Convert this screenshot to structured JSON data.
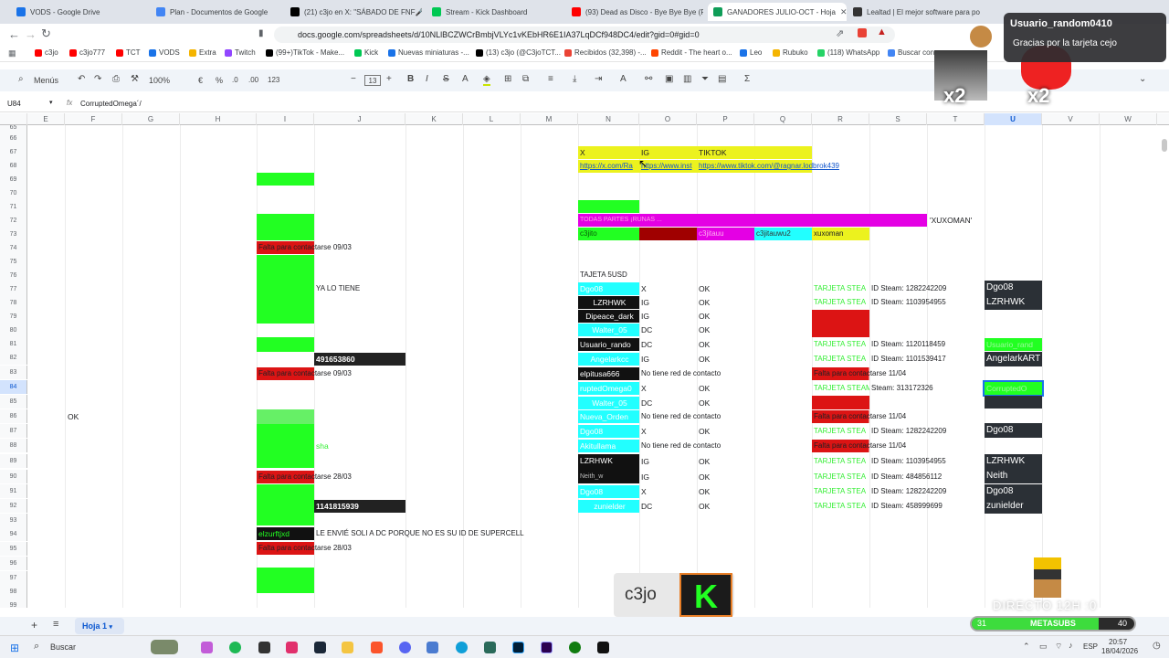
{
  "tabs": [
    {
      "label": "VODS - Google Drive",
      "color": "#1a73e8"
    },
    {
      "label": "Plan - Documentos de Google",
      "color": "#4285f4"
    },
    {
      "label": "(21) c3jo en X: \"SÁBADO DE FNF🎤",
      "color": "#000000"
    },
    {
      "label": "Stream - Kick Dashboard",
      "color": "#00c853"
    },
    {
      "label": "(93) Dead as Disco - Bye Bye Bye (Fr",
      "color": "#ff0000"
    },
    {
      "label": "GANADORES JULIO-OCT - Hoja",
      "color": "#0f9d58"
    },
    {
      "label": "Lealtad | El mejor software para pot",
      "color": "#333333"
    }
  ],
  "url": "docs.google.com/spreadsheets/d/10NLlBCZWCrBmbjVLYc1vKEbHR6E1IA37LqDCf948DC4/edit?gid=0#gid=0",
  "bookmarks": [
    {
      "label": "c3jo",
      "color": "#ff0000"
    },
    {
      "label": "c3jo777",
      "color": "#ff0000"
    },
    {
      "label": "TCT",
      "color": "#ff0000"
    },
    {
      "label": "VODS",
      "color": "#1a73e8"
    },
    {
      "label": "Extra",
      "color": "#f4b400"
    },
    {
      "label": "Twitch",
      "color": "#9146ff"
    },
    {
      "label": "(99+)TikTok - Make...",
      "color": "#000000"
    },
    {
      "label": "Kick",
      "color": "#00c853"
    },
    {
      "label": "Nuevas miniaturas -...",
      "color": "#1a73e8"
    },
    {
      "label": "(13) c3jo (@C3joTCT...",
      "color": "#000000"
    },
    {
      "label": "Recibidos (32,398) -...",
      "color": "#ea4335"
    },
    {
      "label": "Reddit - The heart o...",
      "color": "#ff4500"
    },
    {
      "label": "Leo",
      "color": "#1a73e8"
    },
    {
      "label": "Rubuko",
      "color": "#f4b400"
    },
    {
      "label": "(118) WhatsApp",
      "color": "#25d366"
    },
    {
      "label": "Buscar con",
      "color": "#4285f4"
    }
  ],
  "toolbar": {
    "menus": "Menús",
    "zoom": "100%",
    "currency": "€",
    "percent": "%",
    "dec_minus": ".0",
    "dec_plus": ".00",
    "format": "123",
    "font_size": "13",
    "sigma": "Σ"
  },
  "formula_bar": {
    "cell_ref": "U84",
    "content": "CorruptedOmega´/"
  },
  "columns": [
    "E",
    "F",
    "G",
    "H",
    "I",
    "J",
    "K",
    "L",
    "M",
    "N",
    "O",
    "P",
    "Q",
    "R",
    "S",
    "T",
    "U",
    "V",
    "W"
  ],
  "selected_column": "U",
  "rows": [
    "65",
    "66",
    "67",
    "68",
    "69",
    "70",
    "71",
    "72",
    "73",
    "74",
    "75",
    "76",
    "77",
    "78",
    "79",
    "80",
    "81",
    "82",
    "83",
    "84",
    "85",
    "86",
    "87",
    "88",
    "89",
    "90",
    "91",
    "92",
    "93",
    "94",
    "95",
    "96",
    "97",
    "98",
    "99"
  ],
  "selected_row": "84",
  "cells": {
    "f86": "OK",
    "n67": "X",
    "o67": "IG",
    "p67": "TIKTOK",
    "n68": "https://x.com/Ra",
    "o68": "https://www.inst",
    "p68": "https://www.tiktok.com/@ragnar.lodbrok439",
    "n72": "TODAS PARTES ¡RUNAS ...",
    "t72": "'XUXOMAN'",
    "n73": "c3jito",
    "o73": "",
    "p73": "c3jitauu",
    "q73": "c3jitauwu2",
    "r73": "xuxoman",
    "i74": "Falta para contactarse 09/03",
    "n76": "TAJETA 5USD",
    "j77": "YA LO TIENE",
    "n77": "Dgo08",
    "o77": "X",
    "p77": "OK",
    "r77": "TARJETA STEA",
    "s77": "ID Steam: 1282242209",
    "u77": "Dgo08",
    "n78": "LZRHWK",
    "o78": "IG",
    "p78": "OK",
    "r78": "TARJETA STEA",
    "s78": "ID Steam: 1103954955",
    "u78": "LZRHWK",
    "n79": "Dipeace_dark",
    "o79": "IG",
    "p79": "OK",
    "n80": "Walter_05",
    "o80": "DC",
    "p80": "OK",
    "n81": "Usuario_rando",
    "o81": "DC",
    "p81": "OK",
    "r81": "TARJETA STEA",
    "s81": "ID Steam: 1120118459",
    "u81": "Usuario_rand",
    "j82": "491653860",
    "n82": "Angelarkcc",
    "o82": "IG",
    "p82": "OK",
    "r82": "TARJETA STEA",
    "s82": "ID Steam: 1101539417",
    "u82": "AngelarkART",
    "i83": "Falta para contactarse 09/03",
    "n83": "elpitusa666",
    "o83": "No tiene red de contacto",
    "r83": "Falta para contactarse 11/04",
    "n84": "ruptedOmega0",
    "o84": "X",
    "p84": "OK",
    "r84": "TARJETA STEAM",
    "s84": "Steam: 313172326",
    "u84": "CorruptedO",
    "n85": "Walter_05",
    "o85": "DC",
    "p85": "OK",
    "n86": "Nueva_Orden",
    "o86": "No tiene red de contacto",
    "r86": "Falta para contactarse 11/04",
    "n87": "Dgo08",
    "o87": "X",
    "p87": "OK",
    "r87": "TARJETA STEA",
    "s87": "ID Steam: 1282242209",
    "u87": "Dgo08",
    "j88": "sha",
    "n88": "Akitullama",
    "o88": "No tiene red de contacto",
    "r88": "Falta para contactarse 11/04",
    "n89": "LZRHWK",
    "o89": "IG",
    "p89": "OK",
    "r89": "TARJETA STEA",
    "s89": "ID Steam: 1103954955",
    "u89": "LZRHWK",
    "i90": "Falta para contactarse 28/03",
    "n90": "Neith_w",
    "o90": "IG",
    "p90": "OK",
    "r90": "TARJETA STEA",
    "s90": "ID Steam: 484856112",
    "u90": "Neith",
    "n91": "Dgo08",
    "o91": "X",
    "p91": "OK",
    "r91": "TARJETA STEA",
    "s91": "ID Steam: 1282242209",
    "u91": "Dgo08",
    "j92": "1141815939",
    "n92": "zunielder",
    "o92": "DC",
    "p92": "OK",
    "r92": "TARJETA STEA",
    "s92": "ID Steam: 458999699",
    "u92": "zunielder",
    "i94": "elzurftjxd",
    "j94": "LE ENVIÉ SOLI A DC PORQUE NO ES SU ID DE SUPERCELL",
    "i95": "Falta para contactarse 28/03"
  },
  "sheet_tab": "Hoja 1",
  "overlay": {
    "notif_user": "Usuario_random0410",
    "notif_msg": "Gracias por la tarjeta cejo",
    "multiplier_1": "x2",
    "multiplier_2": "x2",
    "logo_text": "c3jo",
    "directo": "DIRECTO 12H :0",
    "bar_left": "31",
    "bar_label": "METASUBS",
    "bar_right": "40"
  },
  "taskbar": {
    "search": "Buscar",
    "lang": "ESP",
    "time": "20:57",
    "date": "18/04/2026"
  }
}
